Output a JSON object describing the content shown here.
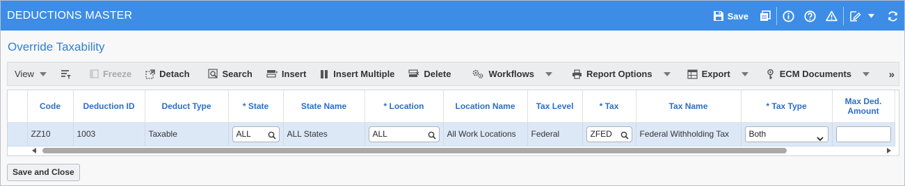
{
  "app": {
    "title": "DEDUCTIONS MASTER"
  },
  "header": {
    "save_label": "Save"
  },
  "subtitle": "Override Taxability",
  "toolbar": {
    "view": "View",
    "freeze": "Freeze",
    "detach": "Detach",
    "search": "Search",
    "insert": "Insert",
    "insert_multiple": "Insert Multiple",
    "delete": "Delete",
    "workflows": "Workflows",
    "report_options": "Report Options",
    "export": "Export",
    "ecm_documents": "ECM Documents",
    "more": "»"
  },
  "grid": {
    "columns": [
      "Code",
      "Deduction ID",
      "Deduct Type",
      "* State",
      "State Name",
      "* Location",
      "Location Name",
      "Tax Level",
      "* Tax",
      "Tax Name",
      "* Tax Type",
      "Max Ded. Amount"
    ],
    "row": {
      "code": "ZZ10",
      "deduction_id": "1003",
      "deduct_type": "Taxable",
      "state": "ALL",
      "state_name": "ALL States",
      "location": "ALL",
      "location_name": "All Work Locations",
      "tax_level": "Federal",
      "tax": "ZFED",
      "tax_name": "Federal Withholding Tax",
      "tax_type": "Both",
      "max_ded_amount": ""
    }
  },
  "footer": {
    "save_close": "Save and Close"
  },
  "colors": {
    "header_bg": "#3d8de6",
    "accent": "#2a6fc9",
    "row_selected": "#dde8f7"
  }
}
